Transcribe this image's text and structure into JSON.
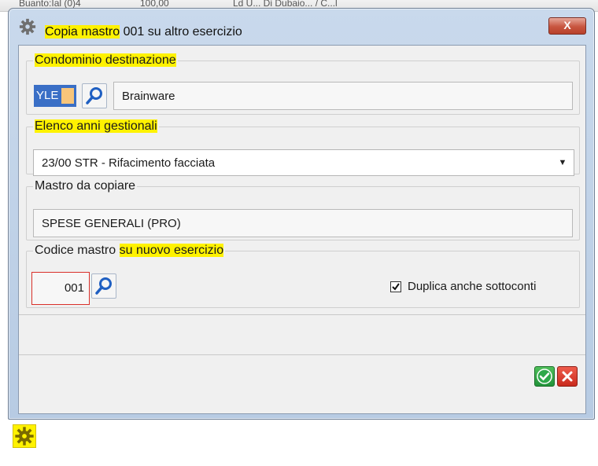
{
  "background": {
    "partial_text_1": "Buanto:Ial (0)4",
    "partial_text_2": "100,00",
    "partial_text_3": "Ld U... Di Dubaio... / C...l"
  },
  "window": {
    "title_prefix": "Copia mastro",
    "title_suffix": " 001 su altro esercizio",
    "close_label": "X"
  },
  "groups": {
    "destinazione": {
      "legend": "Condominio destinazione",
      "code": "YLE",
      "name": "Brainware"
    },
    "anni": {
      "legend": "Elenco anni gestionali",
      "selected": "23/00 STR - Rifacimento facciata"
    },
    "mastro": {
      "legend": "Mastro da copiare",
      "value": "SPESE GENERALI (PRO)"
    },
    "codice": {
      "legend_prefix": "Codice mastro ",
      "legend_highlight": "su nuovo esercizio",
      "value": "001",
      "checkbox_label": "Duplica anche sottoconti",
      "checkbox_checked": true
    }
  },
  "colors": {
    "highlight": "#fff200",
    "ok": "#21923a",
    "cancel": "#c92b1d",
    "selection": "#3a6fc6"
  },
  "icons": {
    "title": "gear-icon",
    "search": "magnifier-icon",
    "ok": "checkmark-icon",
    "cancel": "close-x-icon",
    "taskbar": "gear-icon"
  }
}
